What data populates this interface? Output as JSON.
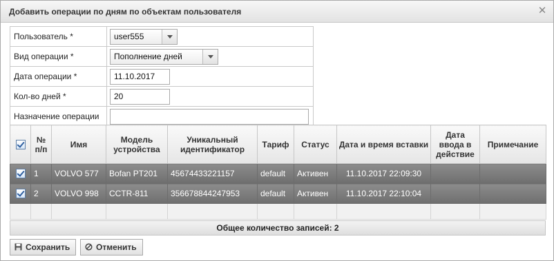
{
  "dialog": {
    "title": "Добавить операции по дням по объектам пользователя"
  },
  "form": {
    "user_label": "Пользователь",
    "user_value": "user555",
    "op_type_label": "Вид операции",
    "op_type_value": "Пополнение дней",
    "date_label": "Дата операции",
    "date_value": "11.10.2017",
    "days_label": "Кол-во дней",
    "days_value": "20",
    "purpose_label": "Назначение операции",
    "purpose_value": "",
    "required_mark": "*"
  },
  "grid": {
    "columns": [
      "№ п/п",
      "Имя",
      "Модель устройства",
      "Уникальный идентификатор",
      "Тариф",
      "Статус",
      "Дата и время вставки",
      "Дата ввода в действие",
      "Примечание"
    ],
    "rows": [
      {
        "num": "1",
        "name": "VOLVO 577",
        "model": "Bofan PT201",
        "uid": "45674433221157",
        "tariff": "default",
        "status": "Активен",
        "inserted": "11.10.2017 22:09:30",
        "effective": "",
        "note": ""
      },
      {
        "num": "2",
        "name": "VOLVO 998",
        "model": "CCTR-811",
        "uid": "356678844247953",
        "tariff": "default",
        "status": "Активен",
        "inserted": "11.10.2017 22:10:04",
        "effective": "",
        "note": ""
      }
    ],
    "total_label": "Общее количество записей: 2"
  },
  "buttons": {
    "save": "Сохранить",
    "cancel": "Отменить"
  },
  "colors": {
    "selected_row": "#7e7e7e",
    "header_bg": "#eeeeee"
  }
}
